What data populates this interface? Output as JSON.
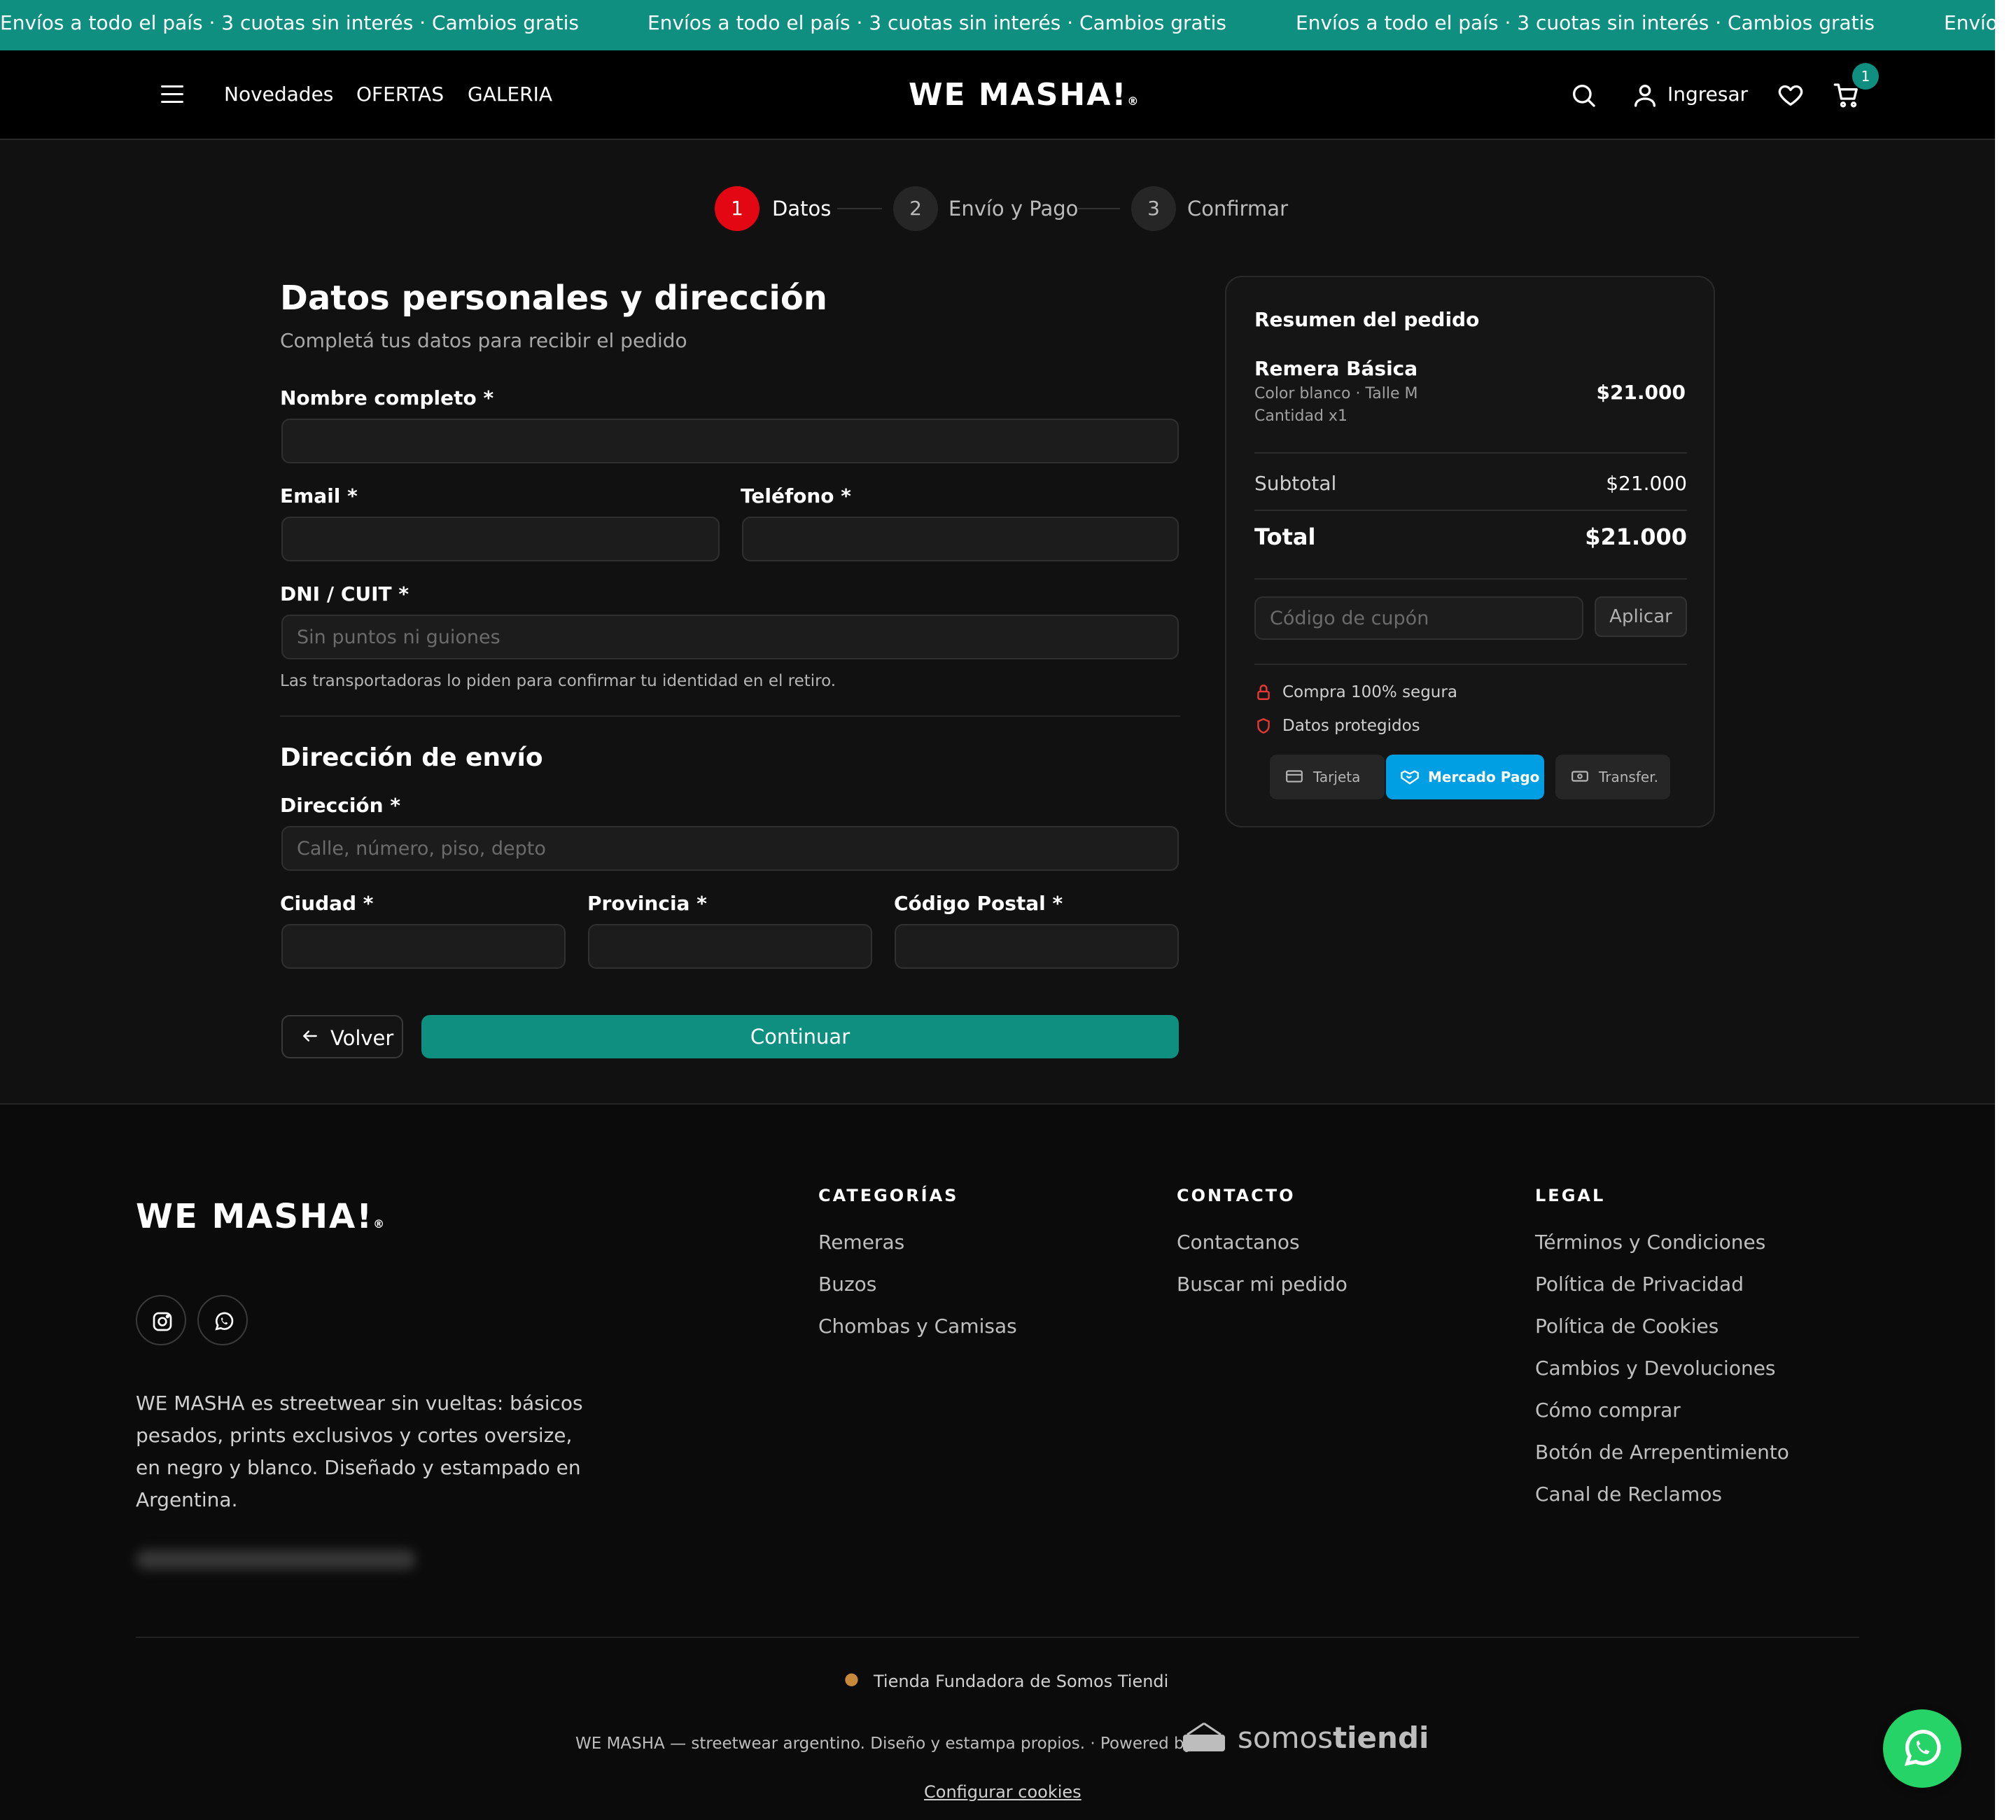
{
  "promo": {
    "text": "Envíos a todo el país · 3 cuotas sin interés · Cambios gratis",
    "tail": "Envío"
  },
  "header": {
    "nav": [
      "Novedades",
      "OFERTAS",
      "GALERIA"
    ],
    "logo": "WE MASHA!",
    "logo_mark": "®",
    "login_label": "Ingresar",
    "cart_count": "1"
  },
  "stepper": {
    "steps": [
      {
        "num": "1",
        "label": "Datos",
        "active": true
      },
      {
        "num": "2",
        "label": "Envío y Pago",
        "active": false
      },
      {
        "num": "3",
        "label": "Confirmar",
        "active": false
      }
    ]
  },
  "form": {
    "title": "Datos personales y dirección",
    "subtitle": "Completá tus datos para recibir el pedido",
    "name_label": "Nombre completo *",
    "email_label": "Email *",
    "phone_label": "Teléfono *",
    "dni_label": "DNI / CUIT *",
    "dni_placeholder": "Sin puntos ni guiones",
    "dni_hint": "Las transportadoras lo piden para confirmar tu identidad en el retiro.",
    "shipping_title": "Dirección de envío",
    "address_label": "Dirección *",
    "address_placeholder": "Calle, número, piso, depto",
    "city_label": "Ciudad *",
    "province_label": "Provincia *",
    "zip_label": "Código Postal *",
    "back_label": "Volver",
    "continue_label": "Continuar"
  },
  "summary": {
    "title": "Resumen del pedido",
    "product_name": "Remera Básica",
    "product_variant": "Color blanco · Talle M",
    "product_qty": "Cantidad x1",
    "product_price": "$21.000",
    "subtotal_label": "Subtotal",
    "subtotal_value": "$21.000",
    "total_label": "Total",
    "total_value": "$21.000",
    "coupon_placeholder": "Código de cupón",
    "apply_label": "Aplicar",
    "trust_secure": "Compra 100% segura",
    "trust_data": "Datos protegidos",
    "pay_card": "Tarjeta",
    "pay_mp": "Mercado Pago",
    "pay_transfer": "Transfer."
  },
  "footer": {
    "logo": "WE MASHA!",
    "logo_mark": "®",
    "about": "WE MASHA es streetwear sin vueltas: básicos pesados, prints exclusivos y cortes oversize, en negro y blanco. Diseñado y estampado en Argentina.",
    "categories_title": "CATEGORÍAS",
    "categories": [
      "Remeras",
      "Buzos",
      "Chombas y Camisas"
    ],
    "contact_title": "CONTACTO",
    "contact": [
      "Contactanos",
      "Buscar mi pedido"
    ],
    "legal_title": "LEGAL",
    "legal": [
      "Términos y Condiciones",
      "Política de Privacidad",
      "Política de Cookies",
      "Cambios y Devoluciones",
      "Cómo comprar",
      "Botón de Arrepentimiento",
      "Canal de Reclamos"
    ],
    "founder": "Tienda Fundadora de Somos Tiendi",
    "powered": "WE MASHA — streetwear argentino. Diseño y estampa propios. · Powered by",
    "somos": "somos",
    "tiendi": "tiendi",
    "cookies": "Configurar cookies"
  },
  "colors": {
    "accent": "#0e8f80",
    "active_step": "#e30613",
    "mercado_pago": "#009ee3",
    "whatsapp": "#25d366"
  }
}
